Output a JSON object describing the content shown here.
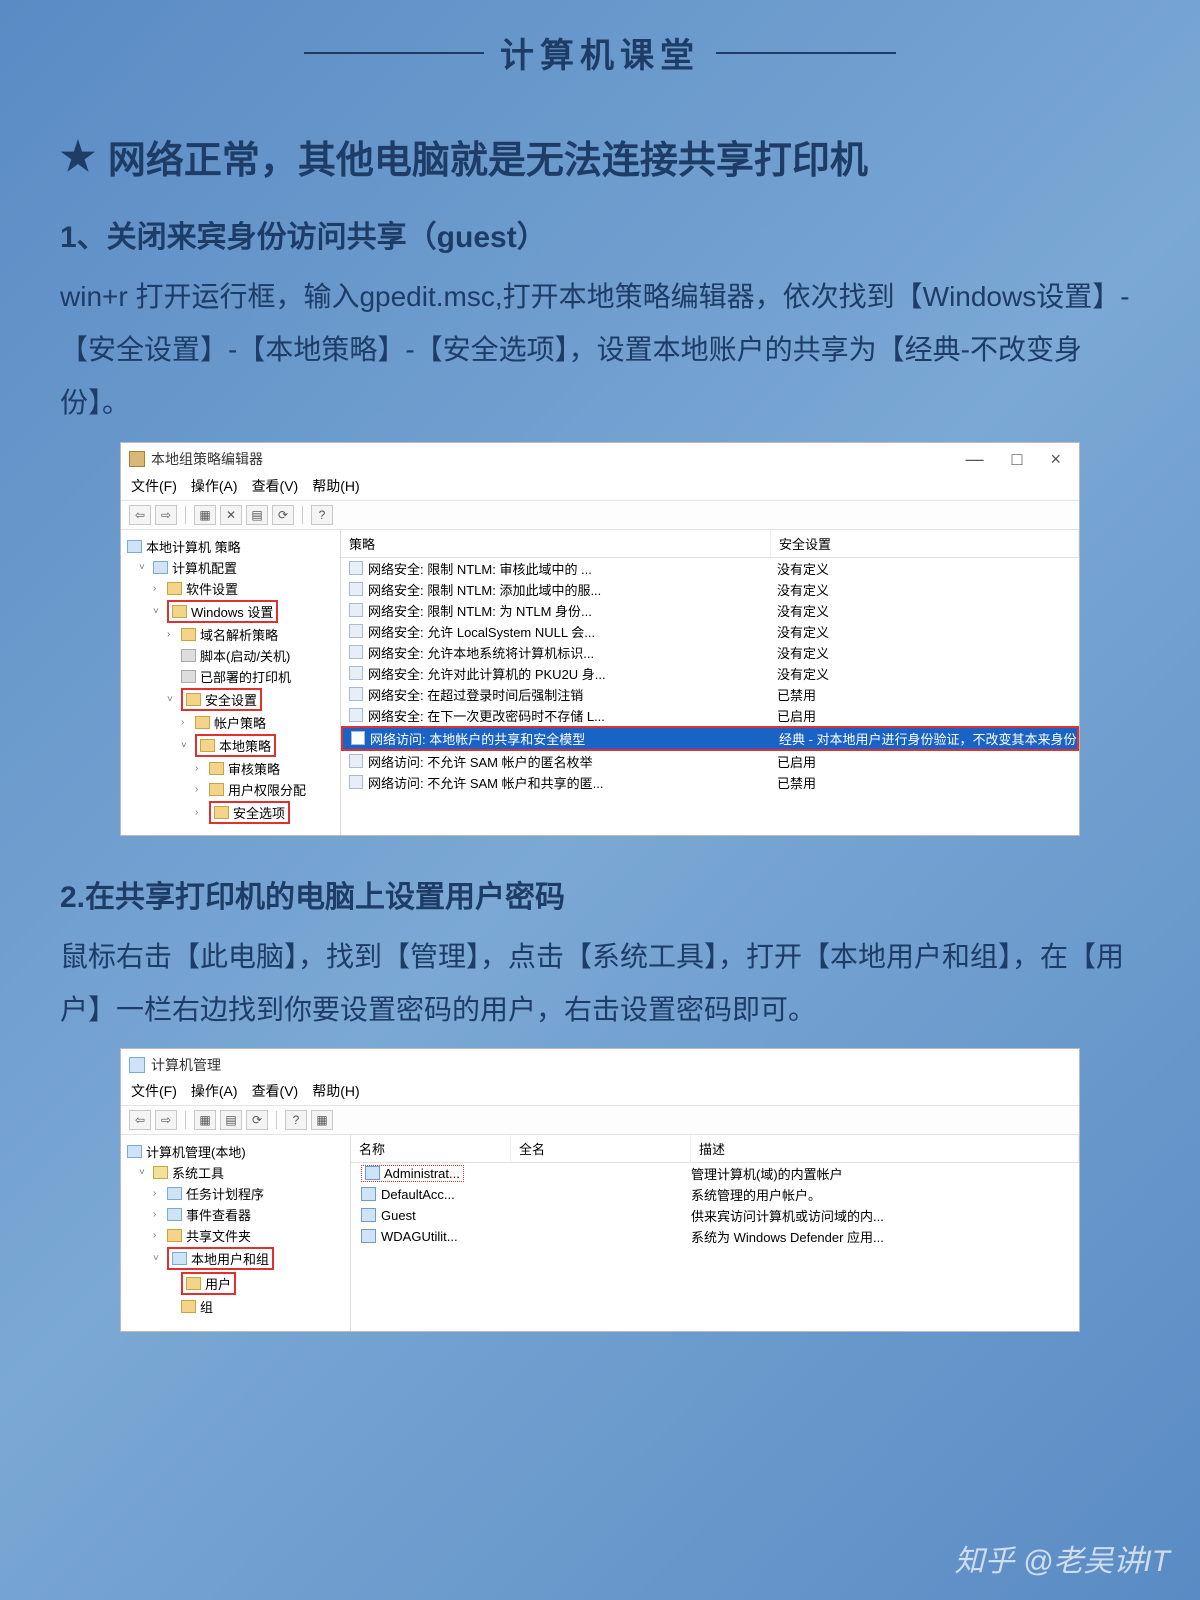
{
  "header": {
    "title": "计算机课堂"
  },
  "main": {
    "star": "★",
    "title": "网络正常，其他电脑就是无法连接共享打印机",
    "step1_title": "1、关闭来宾身份访问共享（guest）",
    "step1_body": "win+r 打开运行框，输入gpedit.msc,打开本地策略编辑器，依次找到【Windows设置】-【安全设置】-【本地策略】-【安全选项】，设置本地账户的共享为【经典-不改变身份】。",
    "step2_title": "2.在共享打印机的电脑上设置用户密码",
    "step2_body": "鼠标右击【此电脑】，找到【管理】，点击【系统工具】，打开【本地用户和组】，在【用户】一栏右边找到你要设置密码的用户，右击设置密码即可。"
  },
  "win1": {
    "title": "本地组策略编辑器",
    "menu": {
      "file": "文件(F)",
      "action": "操作(A)",
      "view": "查看(V)",
      "help": "帮助(H)"
    },
    "win_ctrl": {
      "min": "—",
      "max": "□",
      "close": "×"
    },
    "tree": {
      "root": "本地计算机 策略",
      "n1": "计算机配置",
      "n2": "软件设置",
      "n3": "Windows 设置",
      "n4": "域名解析策略",
      "n5": "脚本(启动/关机)",
      "n6": "已部署的打印机",
      "n7": "安全设置",
      "n8": "帐户策略",
      "n9": "本地策略",
      "n10": "审核策略",
      "n11": "用户权限分配",
      "n12": "安全选项"
    },
    "cols": {
      "policy": "策略",
      "setting": "安全设置"
    },
    "rows": [
      {
        "p": "网络安全: 限制 NTLM: 审核此域中的 ...",
        "s": "没有定义"
      },
      {
        "p": "网络安全: 限制 NTLM: 添加此域中的服...",
        "s": "没有定义"
      },
      {
        "p": "网络安全: 限制 NTLM: 为 NTLM 身份...",
        "s": "没有定义"
      },
      {
        "p": "网络安全: 允许 LocalSystem NULL 会...",
        "s": "没有定义"
      },
      {
        "p": "网络安全: 允许本地系统将计算机标识...",
        "s": "没有定义"
      },
      {
        "p": "网络安全: 允许对此计算机的 PKU2U 身...",
        "s": "没有定义"
      },
      {
        "p": "网络安全: 在超过登录时间后强制注销",
        "s": "已禁用"
      },
      {
        "p": "网络安全: 在下一次更改密码时不存储 L...",
        "s": "已启用"
      },
      {
        "p": "网络访问: 本地帐户的共享和安全模型",
        "s": "经典 - 对本地用户进行身份验证，不改变其本来身份",
        "hl": true
      },
      {
        "p": "网络访问: 不允许 SAM 帐户的匿名枚举",
        "s": "已启用"
      },
      {
        "p": "网络访问: 不允许 SAM 帐户和共享的匿...",
        "s": "已禁用"
      }
    ]
  },
  "win2": {
    "title": "计算机管理",
    "menu": {
      "file": "文件(F)",
      "action": "操作(A)",
      "view": "查看(V)",
      "help": "帮助(H)"
    },
    "tree": {
      "root": "计算机管理(本地)",
      "n1": "系统工具",
      "n2": "任务计划程序",
      "n3": "事件查看器",
      "n4": "共享文件夹",
      "n5": "本地用户和组",
      "n6": "用户",
      "n7": "组"
    },
    "cols": {
      "name": "名称",
      "full": "全名",
      "desc": "描述"
    },
    "rows": [
      {
        "n": "Administrat...",
        "d": "管理计算机(域)的内置帐户",
        "hl": true
      },
      {
        "n": "DefaultAcc...",
        "d": "系统管理的用户帐户。"
      },
      {
        "n": "Guest",
        "d": "供来宾访问计算机或访问域的内..."
      },
      {
        "n": "WDAGUtilit...",
        "d": "系统为 Windows Defender 应用..."
      }
    ]
  },
  "watermark": "知乎 @老吴讲IT"
}
